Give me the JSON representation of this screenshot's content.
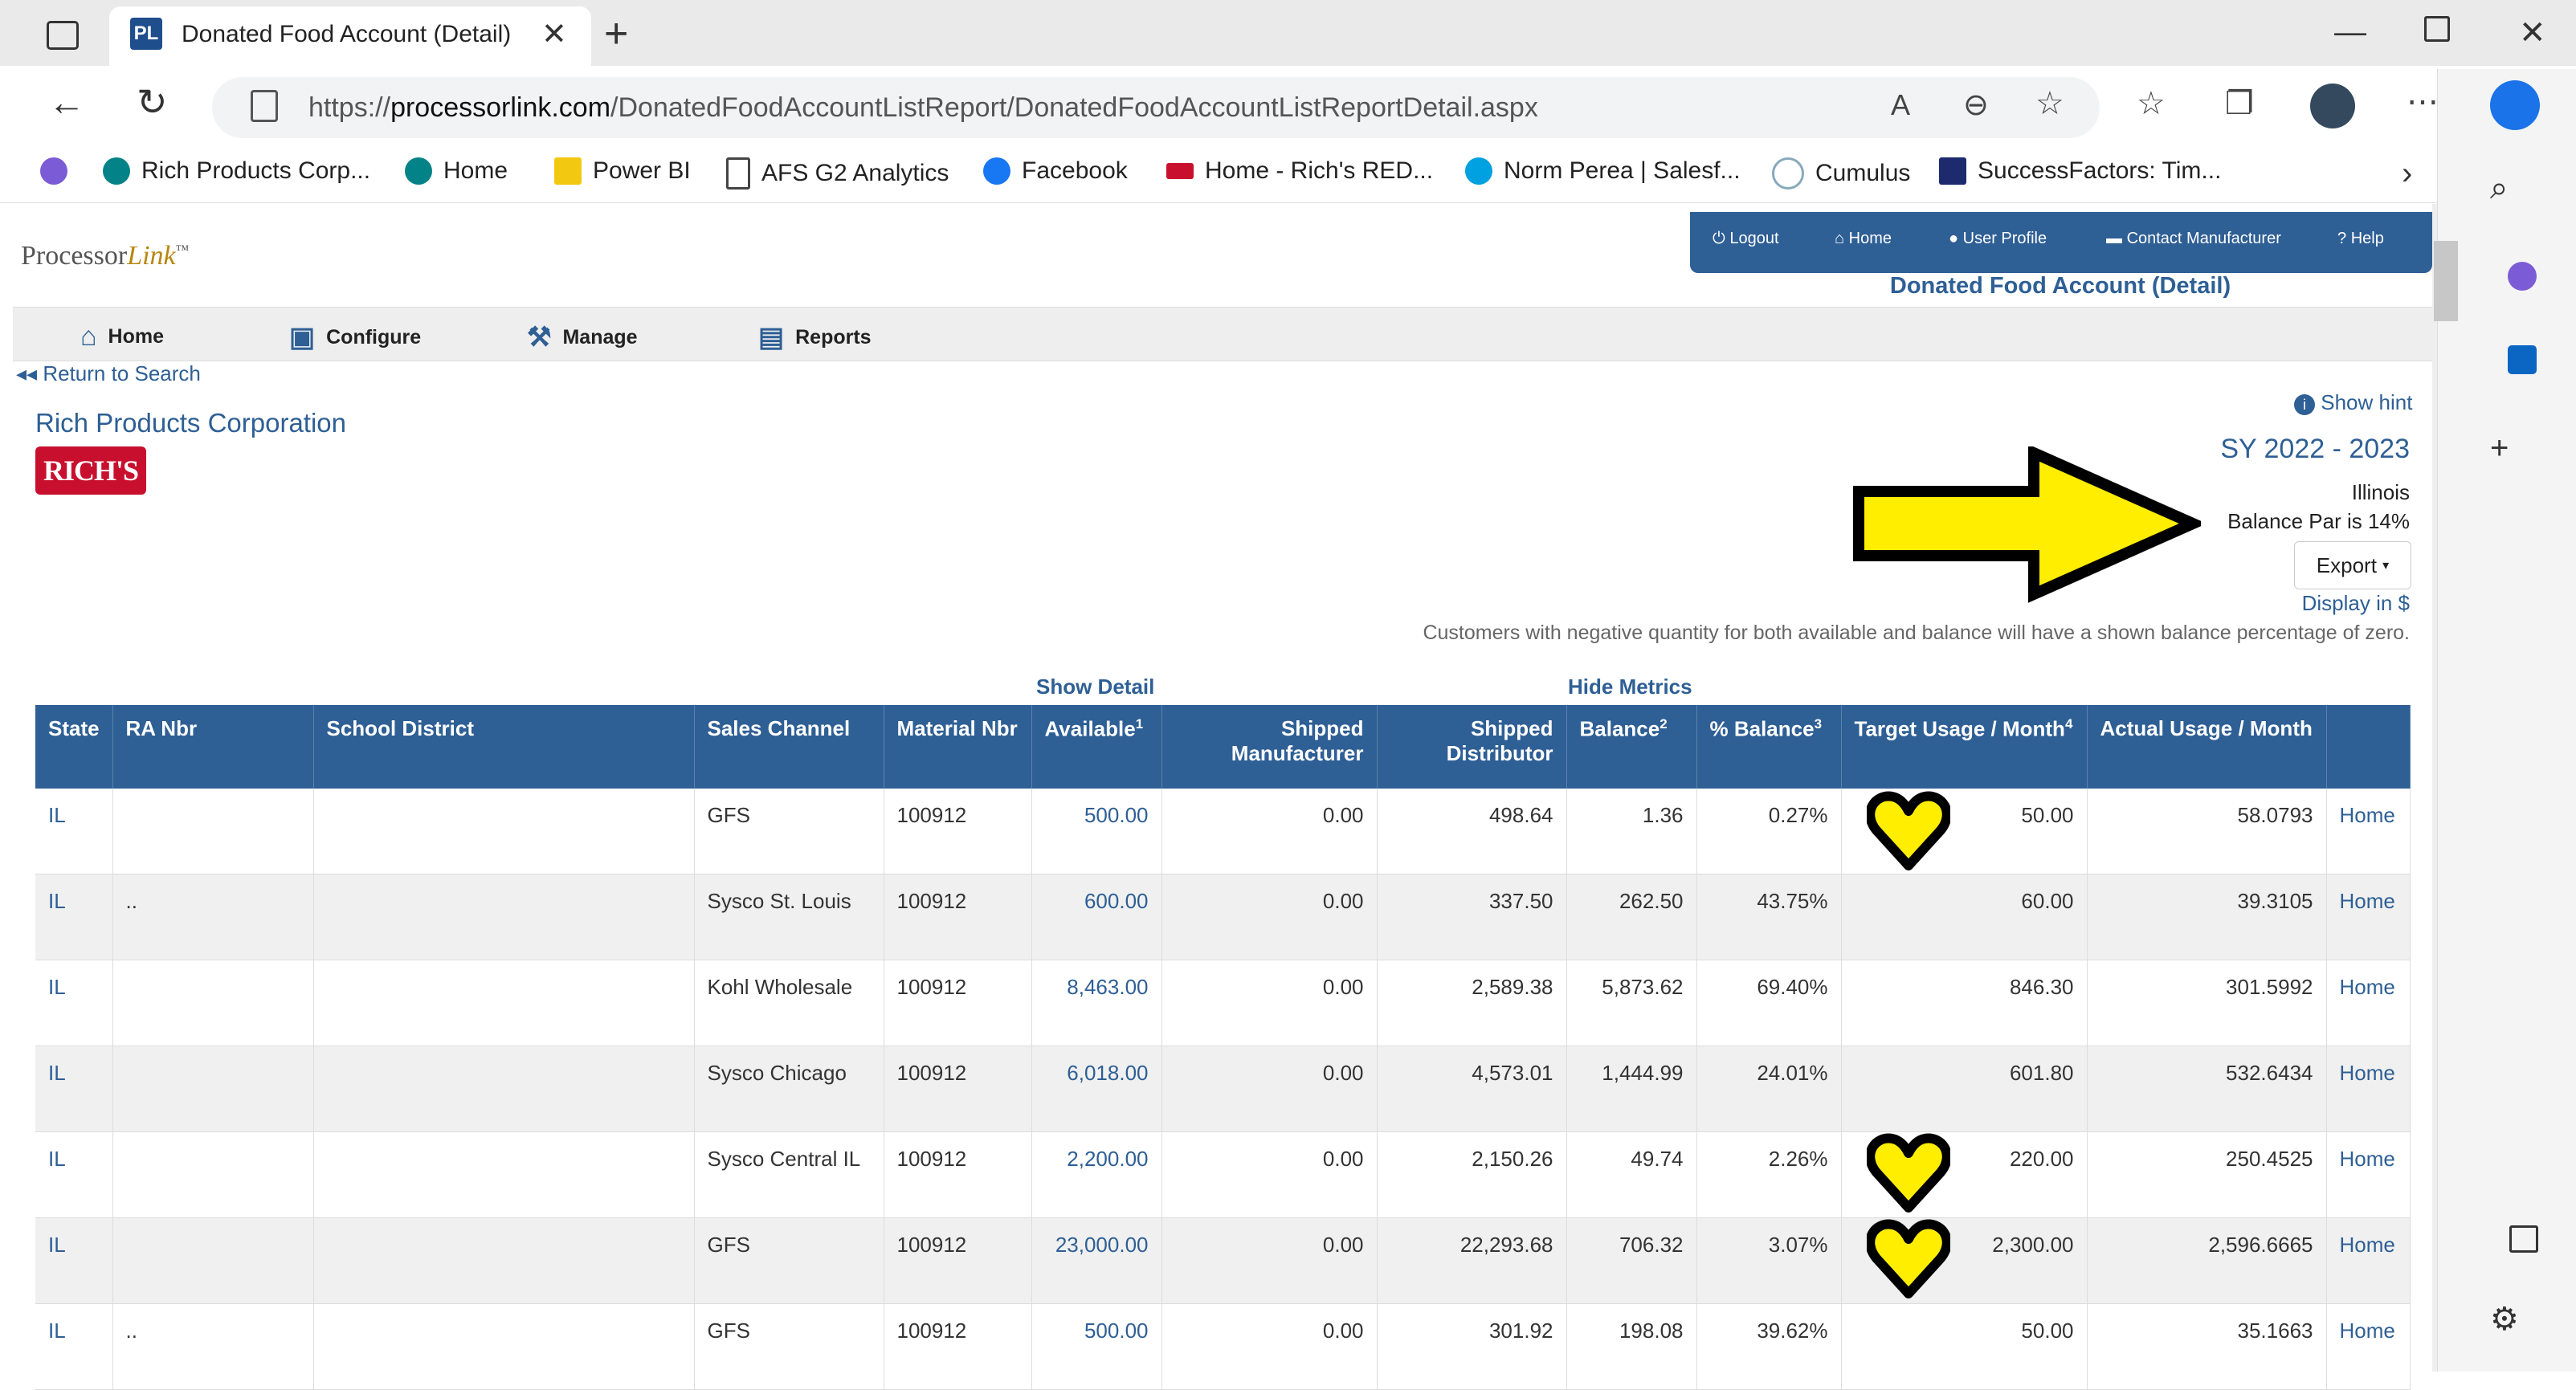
{
  "browser": {
    "tab_title": "Donated Food Account (Detail)",
    "tab_favicon": "PL",
    "url_prefix": "https://",
    "url_domain": "processorlink.com",
    "url_path": "/DonatedFoodAccountListReport/DonatedFoodAccountListReportDetail.aspx",
    "bookmarks": [
      "Rich Products Corp...",
      "Home",
      "Power BI",
      "AFS G2 Analytics",
      "Facebook",
      "Home - Rich's RED...",
      "Norm Perea | Salesf...",
      "Cumulus",
      "SuccessFactors: Tim..."
    ]
  },
  "site": {
    "logo_text_1": "Processor",
    "logo_text_2": "Link",
    "logo_tm": "™",
    "top_nav": [
      "Logout",
      "Home",
      "User Profile",
      "Contact Manufacturer",
      "Help"
    ],
    "page_heading": "Donated Food Account (Detail)",
    "main_nav": [
      "Home",
      "Configure",
      "Manage",
      "Reports"
    ],
    "return_link": "Return to Search"
  },
  "account": {
    "company": "Rich Products Corporation",
    "company_logo": "RICH'S",
    "show_hint": "Show hint",
    "school_year": "SY 2022 - 2023",
    "state": "Illinois",
    "balance_par": "Balance Par is 14%",
    "export_label": "Export",
    "display_link": "Display in $",
    "note": "Customers with negative quantity for both available and balance will have a shown balance percentage of zero.",
    "show_detail": "Show Detail",
    "hide_metrics": "Hide Metrics"
  },
  "table": {
    "headers": [
      "State",
      "RA Nbr",
      "School District",
      "Sales Channel",
      "Material Nbr",
      "Available",
      "Shipped Manufacturer",
      "Shipped Distributor",
      "Balance",
      "% Balance",
      "Target Usage / Month",
      "Actual Usage / Month",
      ""
    ],
    "header_sups": {
      "5": "1",
      "8": "2",
      "9": "3",
      "10": "4"
    },
    "rows": [
      [
        "IL",
        "",
        "",
        "GFS",
        "100912",
        "500.00",
        "0.00",
        "498.64",
        "1.36",
        "0.27%",
        "50.00",
        "58.0793",
        "Home"
      ],
      [
        "IL",
        "..",
        "",
        "Sysco St. Louis",
        "100912",
        "600.00",
        "0.00",
        "337.50",
        "262.50",
        "43.75%",
        "60.00",
        "39.3105",
        "Home"
      ],
      [
        "IL",
        "",
        "",
        "Kohl Wholesale",
        "100912",
        "8,463.00",
        "0.00",
        "2,589.38",
        "5,873.62",
        "69.40%",
        "846.30",
        "301.5992",
        "Home"
      ],
      [
        "IL",
        "",
        "",
        "Sysco Chicago",
        "100912",
        "6,018.00",
        "0.00",
        "4,573.01",
        "1,444.99",
        "24.01%",
        "601.80",
        "532.6434",
        "Home"
      ],
      [
        "IL",
        "",
        "",
        "Sysco Central IL",
        "100912",
        "2,200.00",
        "0.00",
        "2,150.26",
        "49.74",
        "2.26%",
        "220.00",
        "250.4525",
        "Home"
      ],
      [
        "IL",
        "",
        "",
        "GFS",
        "100912",
        "23,000.00",
        "0.00",
        "22,293.68",
        "706.32",
        "3.07%",
        "2,300.00",
        "2,596.6665",
        "Home"
      ],
      [
        "IL",
        "..",
        "",
        "GFS",
        "100912",
        "500.00",
        "0.00",
        "301.92",
        "198.08",
        "39.62%",
        "50.00",
        "35.1663",
        "Home"
      ]
    ]
  },
  "annotations": {
    "arrow_color": "#ffee00",
    "heart_color": "#ffee00",
    "hearts_on_rows": [
      0,
      4,
      5
    ]
  },
  "colors": {
    "brand_blue": "#2e5f95",
    "richs_red": "#c8102e"
  }
}
